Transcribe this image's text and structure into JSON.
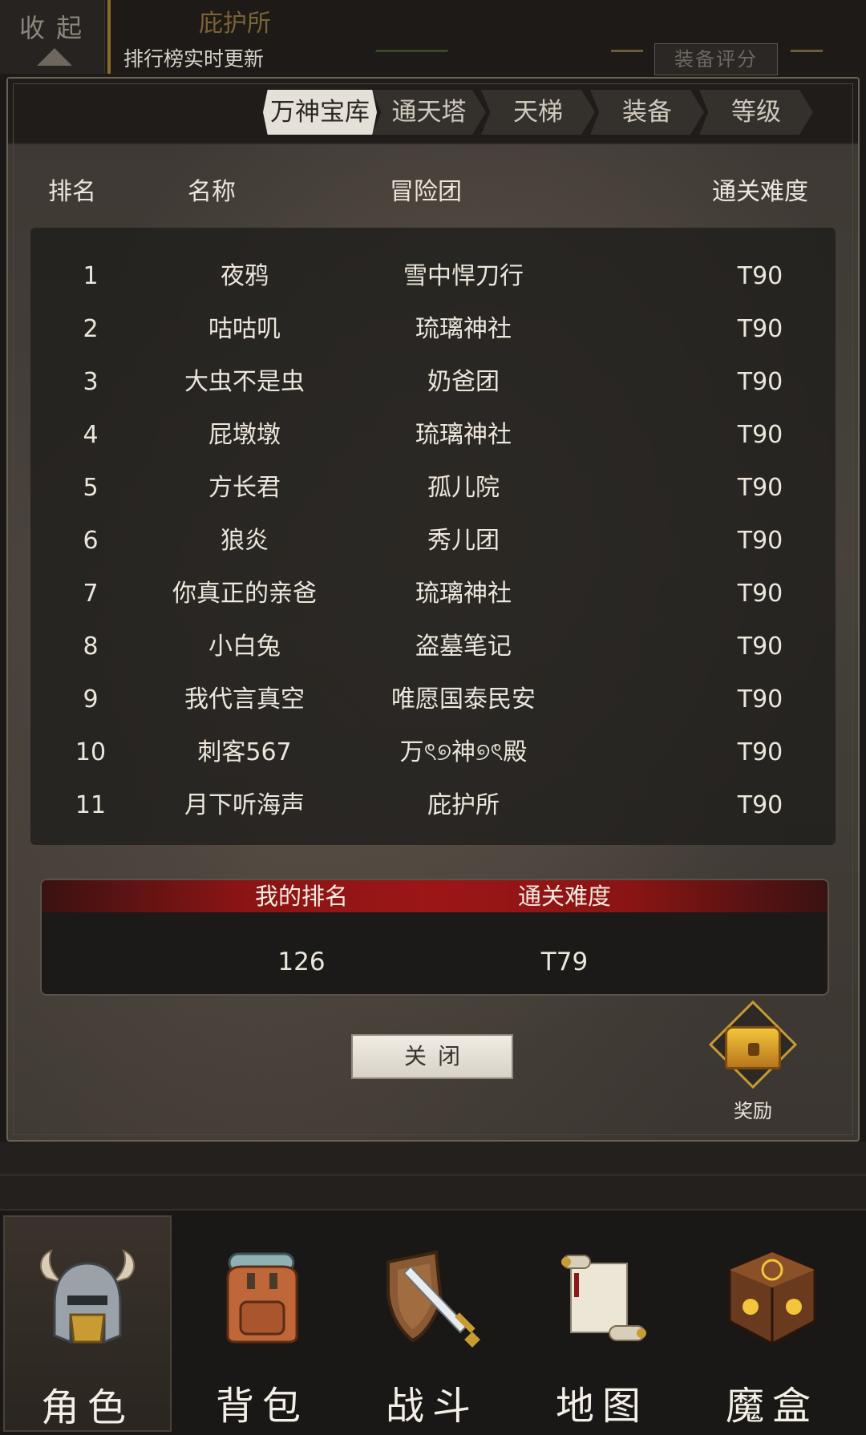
{
  "topbar": {
    "collapse_label": "收 起",
    "team_name": "庇护所",
    "note": "排行榜实时更新",
    "score_tab": "装备评分"
  },
  "tabs": [
    {
      "label": "万神宝库",
      "active": true
    },
    {
      "label": "通天塔",
      "active": false
    },
    {
      "label": "天梯",
      "active": false
    },
    {
      "label": "装备",
      "active": false
    },
    {
      "label": "等级",
      "active": false
    }
  ],
  "table": {
    "headers": {
      "rank": "排名",
      "name": "名称",
      "team": "冒险团",
      "difficulty": "通关难度"
    },
    "rows": [
      {
        "rank": "1",
        "name": "夜鸦",
        "team": "雪中悍刀行",
        "difficulty": "T90"
      },
      {
        "rank": "2",
        "name": "咕咕叽",
        "team": "琉璃神社",
        "difficulty": "T90"
      },
      {
        "rank": "3",
        "name": "大虫不是虫",
        "team": "奶爸团",
        "difficulty": "T90"
      },
      {
        "rank": "4",
        "name": "屁墩墩",
        "team": "琉璃神社",
        "difficulty": "T90"
      },
      {
        "rank": "5",
        "name": "方长君",
        "team": "孤儿院",
        "difficulty": "T90"
      },
      {
        "rank": "6",
        "name": "狼炎",
        "team": "秀儿团",
        "difficulty": "T90"
      },
      {
        "rank": "7",
        "name": "你真正的亲爸",
        "team": "琉璃神社",
        "difficulty": "T90"
      },
      {
        "rank": "8",
        "name": "小白兔",
        "team": "盗墓笔记",
        "difficulty": "T90"
      },
      {
        "rank": "9",
        "name": "我代言真空",
        "team": "唯愿国泰民安",
        "difficulty": "T90"
      },
      {
        "rank": "10",
        "name": "刺客567",
        "team": "万ৎ୭神୭ৎ殿",
        "difficulty": "T90"
      },
      {
        "rank": "11",
        "name": "月下听海声",
        "team": "庇护所",
        "difficulty": "T90"
      }
    ]
  },
  "my_rank": {
    "rank_label": "我的排名",
    "difficulty_label": "通关难度",
    "rank_value": "126",
    "difficulty_value": "T79"
  },
  "close_label": "关闭",
  "reward_label": "奖励",
  "nav": [
    {
      "label": "角色",
      "icon": "helmet-icon",
      "active": true
    },
    {
      "label": "背包",
      "icon": "backpack-icon",
      "active": false
    },
    {
      "label": "战斗",
      "icon": "sword-shield-icon",
      "active": false
    },
    {
      "label": "地图",
      "icon": "scroll-map-icon",
      "active": false
    },
    {
      "label": "魔盒",
      "icon": "magic-box-icon",
      "active": false
    }
  ],
  "colors": {
    "accent_red": "#9c1616",
    "gold": "#c79a36",
    "panel": "#3d3833"
  }
}
